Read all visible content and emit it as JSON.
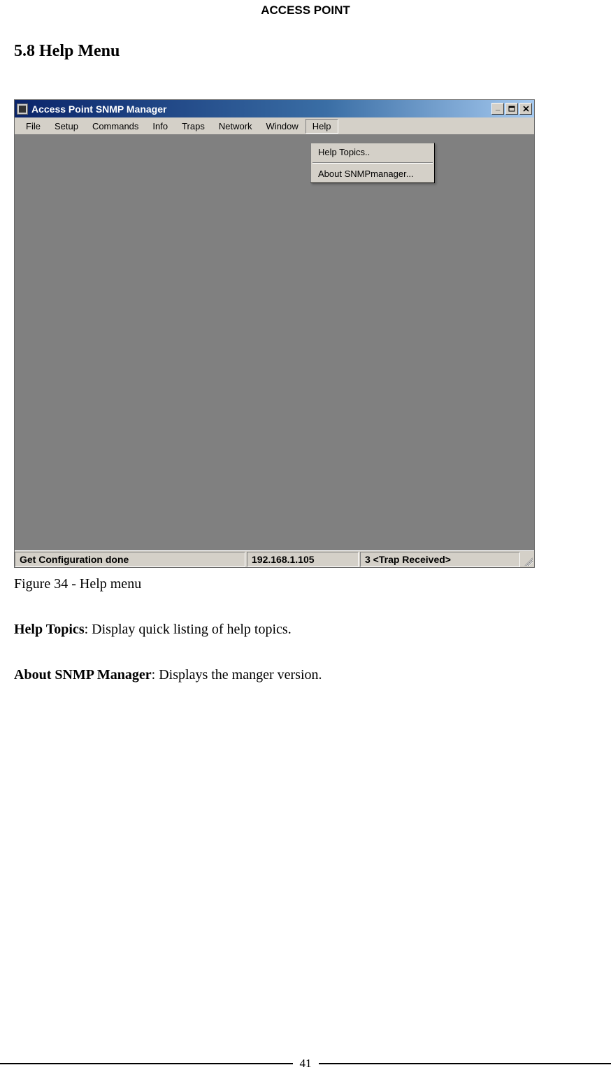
{
  "header": "ACCESS POINT",
  "section_title": "5.8 Help Menu",
  "window": {
    "title": "Access Point SNMP Manager",
    "menubar": [
      "File",
      "Setup",
      "Commands",
      "Info",
      "Traps",
      "Network",
      "Window",
      "Help"
    ],
    "dropdown": {
      "item1": "Help Topics..",
      "item2": "About SNMPmanager..."
    },
    "statusbar": {
      "cell1": "Get Configuration done",
      "cell2": "192.168.1.105",
      "cell3": "3 <Trap Received>"
    },
    "controls": {
      "min": "_",
      "restore": "◻",
      "close": "✕"
    }
  },
  "caption": "Figure 34 - Help menu",
  "para1_bold": "Help Topics",
  "para1_rest": ": Display quick listing of help topics.",
  "para2_bold": "About SNMP Manager",
  "para2_rest": ": Displays the manger version.",
  "page_number": "41"
}
